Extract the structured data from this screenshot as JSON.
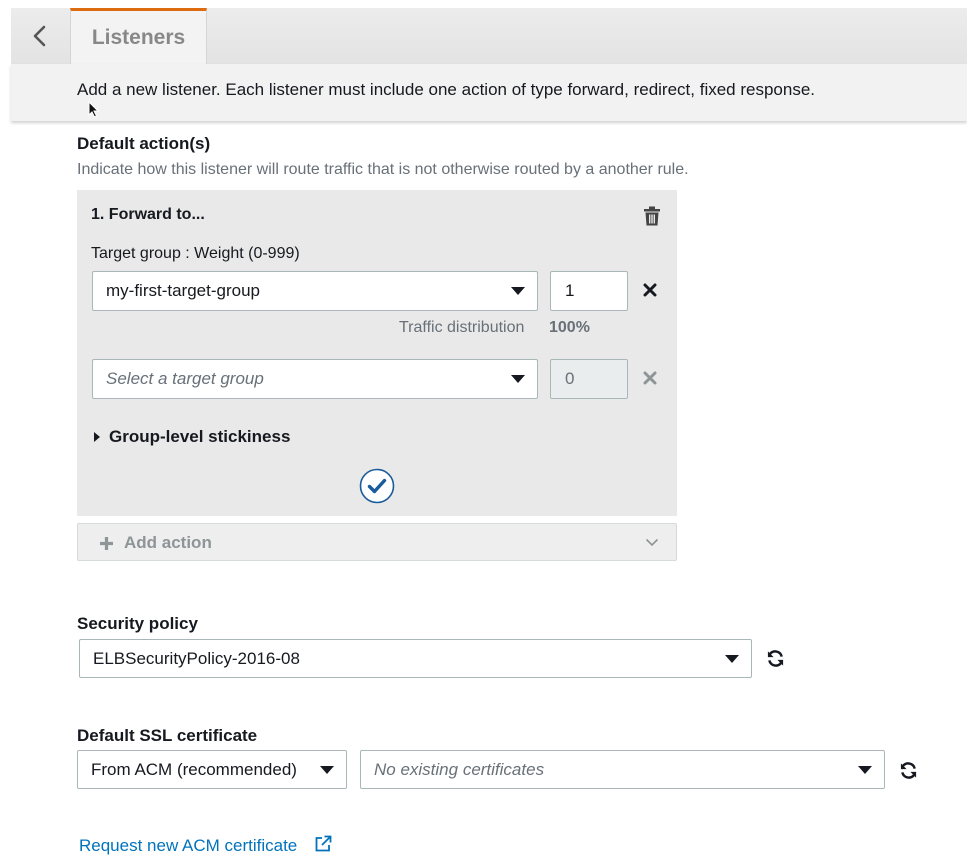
{
  "header": {
    "tab_label": "Listeners",
    "info_text": "Add a new listener. Each listener must include one action of type forward, redirect, fixed response."
  },
  "default_actions": {
    "title": "Default action(s)",
    "description": "Indicate how this listener will route traffic that is not otherwise routed by a another rule.",
    "action": {
      "title": "1. Forward to...",
      "target_group_label": "Target group : Weight (0-999)",
      "rows": [
        {
          "target_group": "my-first-target-group",
          "weight": "1"
        },
        {
          "placeholder": "Select a target group",
          "weight": "0"
        }
      ],
      "traffic_label": "Traffic distribution",
      "traffic_value": "100%",
      "stickiness_label": "Group-level stickiness"
    },
    "add_action_label": "Add action"
  },
  "security_policy": {
    "label": "Security policy",
    "value": "ELBSecurityPolicy-2016-08"
  },
  "ssl_certificate": {
    "label": "Default SSL certificate",
    "source_value": "From ACM (recommended)",
    "certificate_placeholder": "No existing certificates",
    "request_link": "Request new ACM certificate"
  },
  "colors": {
    "accent_tab": "#dd6b10",
    "link": "#0073bb",
    "confirm": "#1a5b9c"
  }
}
